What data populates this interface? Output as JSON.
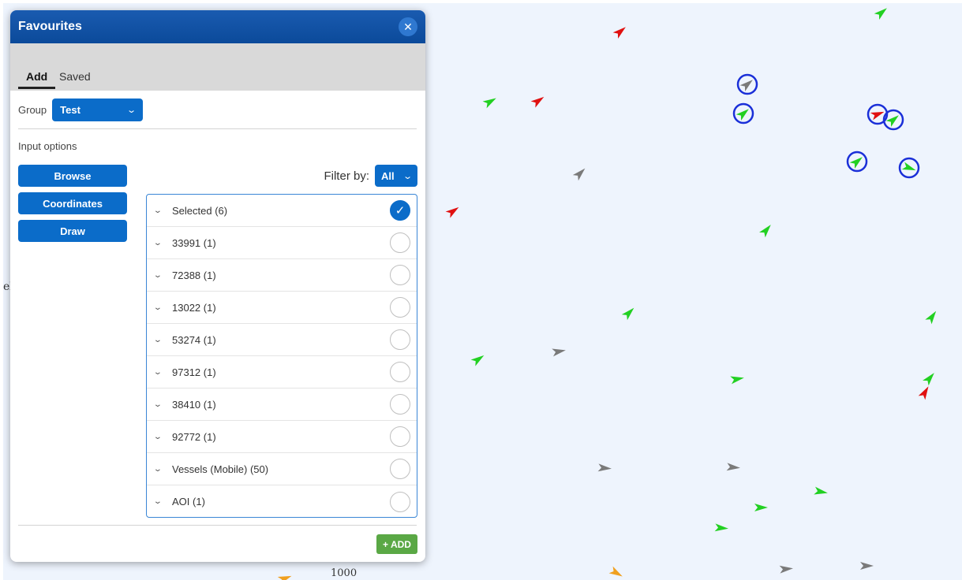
{
  "panel": {
    "title": "Favourites",
    "close_icon": "close-icon",
    "tabs": [
      {
        "label": "Add",
        "active": true
      },
      {
        "label": "Saved",
        "active": false
      }
    ],
    "group": {
      "label": "Group",
      "value": "Test"
    },
    "input_options": {
      "label": "Input options",
      "buttons": [
        "Browse",
        "Coordinates",
        "Draw"
      ]
    },
    "filter": {
      "label": "Filter by:",
      "value": "All"
    },
    "list": [
      {
        "label": "Selected (6)",
        "checked": true
      },
      {
        "label": "33991 (1)",
        "checked": false
      },
      {
        "label": "72388 (1)",
        "checked": false
      },
      {
        "label": "13022 (1)",
        "checked": false
      },
      {
        "label": "53274 (1)",
        "checked": false
      },
      {
        "label": "97312 (1)",
        "checked": false
      },
      {
        "label": "38410 (1)",
        "checked": false
      },
      {
        "label": "92772 (1)",
        "checked": false
      },
      {
        "label": "Vessels (Mobile) (50)",
        "checked": false
      },
      {
        "label": "AOI (1)",
        "checked": false
      }
    ],
    "add_button": "+ ADD"
  },
  "map": {
    "depth_label": "1000",
    "edge_label": "el",
    "colors": {
      "green": "#22d022",
      "red": "#e01010",
      "grey": "#7a7a7a",
      "orange": "#f0a020",
      "ring": "#1a2fd8"
    }
  }
}
